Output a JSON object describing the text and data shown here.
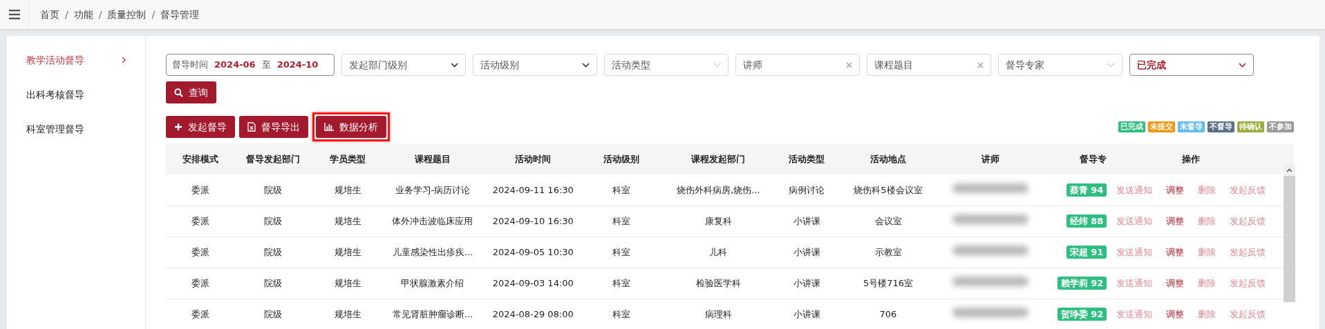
{
  "breadcrumb": [
    {
      "label": "首页"
    },
    {
      "separator": "/",
      "label": "功能"
    },
    {
      "separator": "/",
      "label": "质量控制"
    },
    {
      "separator": "/",
      "label": "督导管理"
    }
  ],
  "sidebar": {
    "items": [
      {
        "label": "教学活动督导",
        "selected": true
      },
      {
        "label": "出科考核督导",
        "selected": false
      },
      {
        "label": "科室管理督导",
        "selected": false
      }
    ]
  },
  "filters": {
    "date_range": {
      "label": "督导时间",
      "from": "2024-06",
      "separator": "至",
      "to": "2024-10"
    },
    "fields": [
      {
        "kind": "select",
        "placeholder": "发起部门级别"
      },
      {
        "kind": "select",
        "placeholder": "活动级别"
      },
      {
        "kind": "combo",
        "placeholder": "活动类型"
      },
      {
        "kind": "clearable",
        "placeholder": "讲师"
      },
      {
        "kind": "clearable",
        "placeholder": "课程题目"
      },
      {
        "kind": "combo",
        "placeholder": "督导专家"
      },
      {
        "kind": "select",
        "value": "已完成"
      }
    ],
    "search_button": "查询"
  },
  "actions": [
    {
      "kind": "add",
      "label": "发起督导",
      "highlighted": false
    },
    {
      "kind": "export",
      "label": "督导导出",
      "highlighted": false
    },
    {
      "kind": "chart",
      "label": "数据分析",
      "highlighted": true
    }
  ],
  "legend": [
    {
      "label": "已完成",
      "color": "#2dbf80"
    },
    {
      "label": "未提交",
      "color": "#f5960a"
    },
    {
      "label": "未督导",
      "color": "#62bdea"
    },
    {
      "label": "不督导",
      "color": "#587080"
    },
    {
      "label": "待确认",
      "color": "#9cac3c"
    },
    {
      "label": "不参加",
      "color": "#9a9a9a"
    }
  ],
  "table": {
    "columns": [
      "安排模式",
      "督导发起部门",
      "学员类型",
      "课程题目",
      "活动时间",
      "活动级别",
      "课程发起部门",
      "活动类型",
      "活动地点",
      "讲师",
      "督导专",
      "操作"
    ],
    "rows": [
      {
        "cells": [
          "委派",
          "院级",
          "规培生",
          "业务学习-病历讨论",
          "2024-09-11 16:30",
          "科室",
          "烧伤外科病房,烧伤...",
          "病例讨论",
          "烧伤科5楼会议室"
        ],
        "expert": {
          "label": "蔡青 94",
          "color": "#2dbf80"
        },
        "actions": [
          {
            "label": "发送通知",
            "disabled": true
          },
          {
            "label": "调整",
            "disabled": false
          },
          {
            "label": "删除",
            "disabled": true
          },
          {
            "label": "发起反馈",
            "disabled": true
          }
        ]
      },
      {
        "cells": [
          "委派",
          "院级",
          "规培生",
          "体外冲击波临床应用",
          "2024-09-10 16:30",
          "科室",
          "康复科",
          "小讲课",
          "会议室"
        ],
        "expert": {
          "label": "经纬 88",
          "color": "#2dbf80"
        },
        "actions": [
          {
            "label": "发送通知",
            "disabled": true
          },
          {
            "label": "调整",
            "disabled": false
          },
          {
            "label": "删除",
            "disabled": true
          },
          {
            "label": "发起反馈",
            "disabled": true
          }
        ]
      },
      {
        "cells": [
          "委派",
          "院级",
          "规培生",
          "儿童感染性出疹疾...",
          "2024-09-05 10:30",
          "科室",
          "儿科",
          "小讲课",
          "示教室"
        ],
        "expert": {
          "label": "宋超 91",
          "color": "#2dbf80"
        },
        "actions": [
          {
            "label": "发送通知",
            "disabled": true
          },
          {
            "label": "调整",
            "disabled": false
          },
          {
            "label": "删除",
            "disabled": true
          },
          {
            "label": "发起反馈",
            "disabled": true
          }
        ]
      },
      {
        "cells": [
          "委派",
          "院级",
          "规培生",
          "甲状腺激素介绍",
          "2024-09-03 14:00",
          "科室",
          "检验医学科",
          "小讲课",
          "5号楼716室"
        ],
        "expert": {
          "label": "赖学莉 92",
          "color": "#2dbf80"
        },
        "actions": [
          {
            "label": "发送通知",
            "disabled": true
          },
          {
            "label": "调整",
            "disabled": false
          },
          {
            "label": "删除",
            "disabled": true
          },
          {
            "label": "发起反馈",
            "disabled": true
          }
        ]
      },
      {
        "cells": [
          "委派",
          "院级",
          "规培生",
          "常见肾脏肿瘤诊断...",
          "2024-08-29 08:00",
          "科室",
          "病理科",
          "小讲课",
          "706"
        ],
        "expert": {
          "label": "贺琤委 92",
          "color": "#2dbf80"
        },
        "actions": [
          {
            "label": "发送通知",
            "disabled": true
          },
          {
            "label": "调整",
            "disabled": false
          },
          {
            "label": "删除",
            "disabled": true
          },
          {
            "label": "发起反馈",
            "disabled": true
          }
        ]
      }
    ]
  }
}
